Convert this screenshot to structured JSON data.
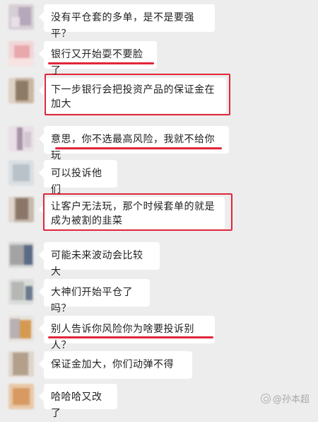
{
  "messages": [
    {
      "text": "没有平仓套的多单，是不是要强平？"
    },
    {
      "text": "银行又开始耍不要脸了"
    },
    {
      "text": "下一步银行会把投资产品的保证金在加大"
    },
    {
      "text": "意思，你不选最高风险，我就不给你玩"
    },
    {
      "text": "可以投诉他们"
    },
    {
      "text": "让客户无法玩，那个时候套单的就是成为被割的韭菜"
    },
    {
      "text": "可能未来波动会比较大"
    },
    {
      "text": "大神们开始平仓了吗？"
    },
    {
      "text": "别人告诉你风险你为啥要投诉别人？"
    },
    {
      "text": "保证金加大，你们动弹不得"
    },
    {
      "text": "哈哈哈又改了"
    }
  ],
  "watermark": {
    "text": "@孙本超"
  }
}
